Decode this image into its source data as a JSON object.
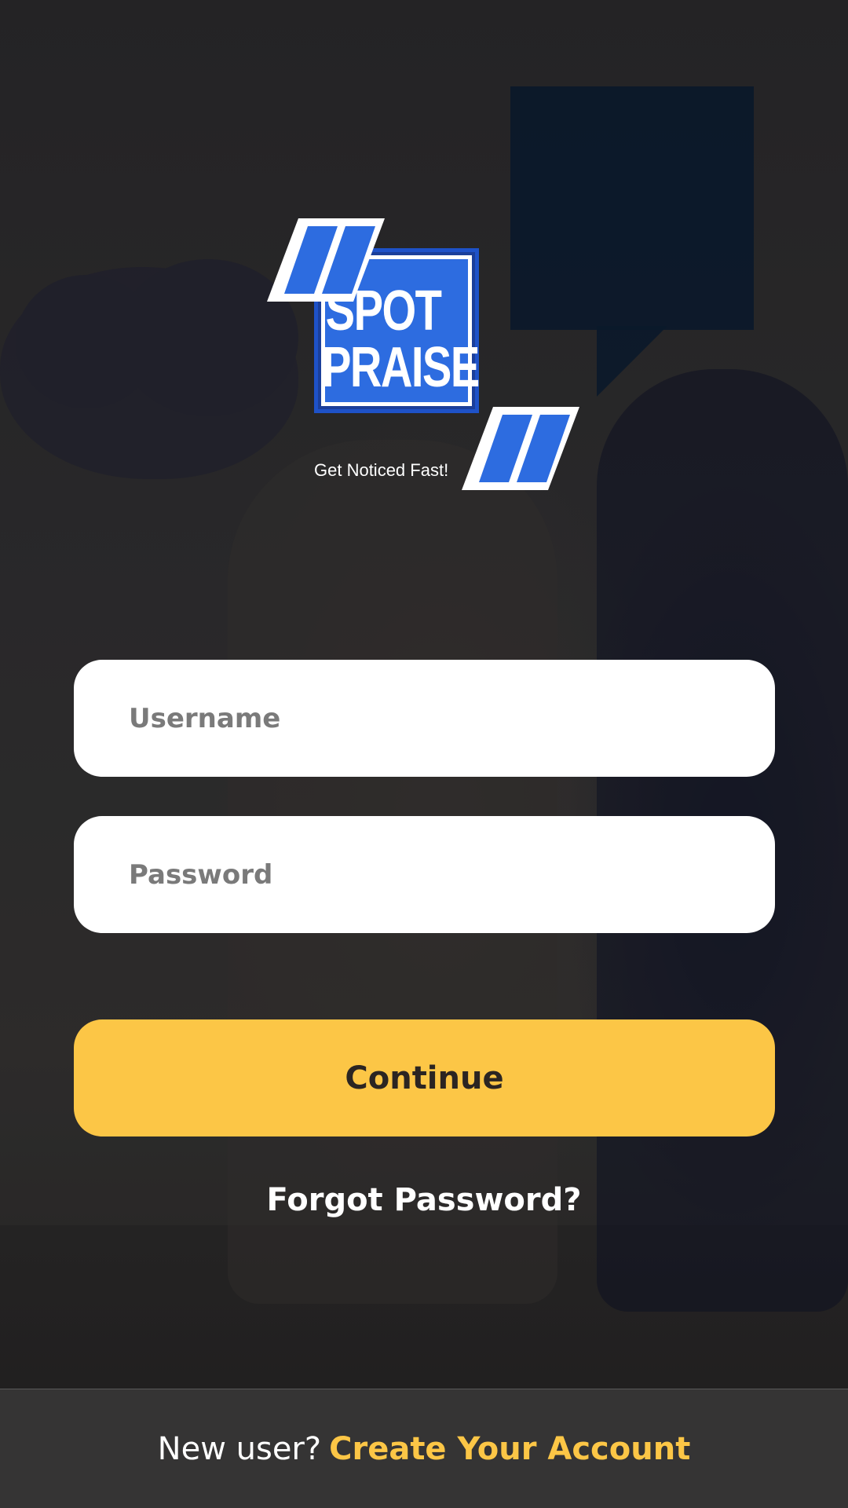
{
  "logo": {
    "line1": "SPOT",
    "line2": "PRAISE",
    "tagline": "Get Noticed Fast!"
  },
  "form": {
    "username_placeholder": "Username",
    "password_placeholder": "Password",
    "continue_label": "Continue",
    "forgot_label": "Forgot Password?"
  },
  "footer": {
    "question": "New user?",
    "create_label": "Create Your Account"
  },
  "colors": {
    "accent": "#fcc646",
    "brand_blue": "#2d6ce0",
    "background": "#2b2a2c"
  }
}
